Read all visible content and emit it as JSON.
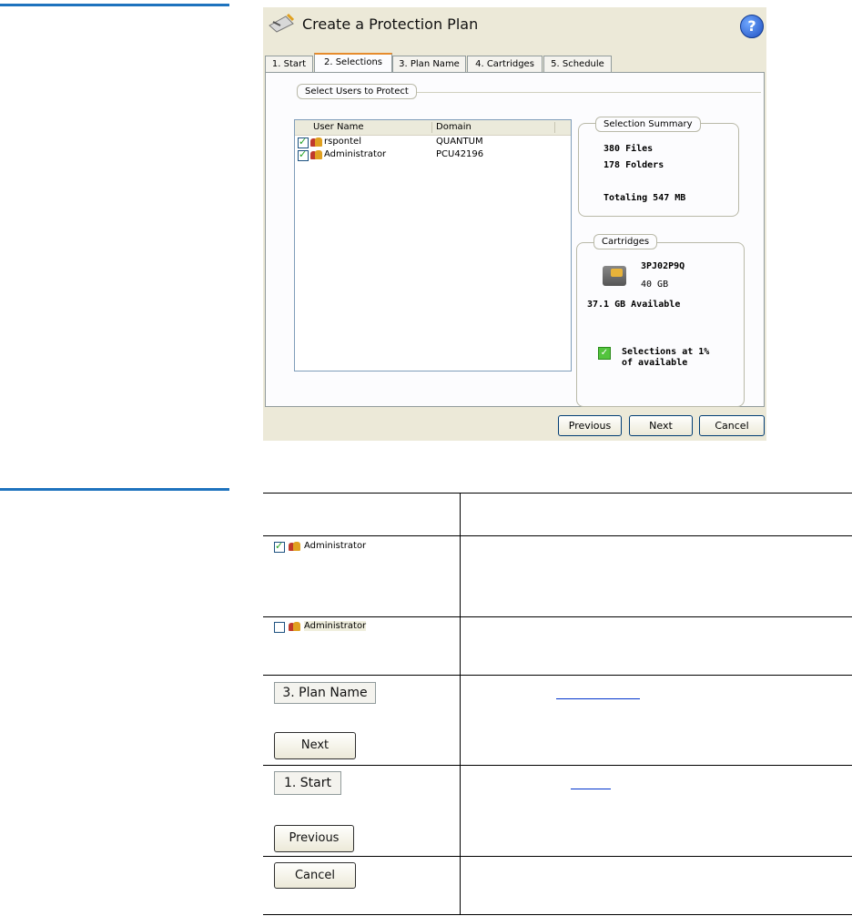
{
  "window": {
    "title": "Create a Protection Plan",
    "help_label": "?"
  },
  "tabs": [
    {
      "label": "1. Start"
    },
    {
      "label": "2. Selections"
    },
    {
      "label": "3. Plan Name"
    },
    {
      "label": "4. Cartridges"
    },
    {
      "label": "5. Schedule"
    }
  ],
  "users_group": {
    "legend": "Select Users to Protect",
    "columns": [
      "User Name",
      "Domain"
    ],
    "rows": [
      {
        "user": "rspontel",
        "domain": "QUANTUM",
        "checked": true
      },
      {
        "user": "Administrator",
        "domain": "PCU42196",
        "checked": true
      }
    ]
  },
  "summary": {
    "legend": "Selection Summary",
    "files": "380 Files",
    "folders": "178 Folders",
    "total": "Totaling 547 MB"
  },
  "cartridges": {
    "legend": "Cartridges",
    "id": "3PJ02P9Q",
    "size": "40 GB",
    "available": "37.1 GB Available",
    "status_line1": "Selections at 1%",
    "status_line2": "of available"
  },
  "buttons": {
    "previous": "Previous",
    "next": "Next",
    "cancel": "Cancel"
  },
  "reference_table": {
    "checked_item": "Administrator",
    "unchecked_item": "Administrator",
    "plan_name_tab": "3. Plan Name",
    "next": "Next",
    "start_tab": "1. Start",
    "previous": "Previous",
    "cancel": "Cancel"
  }
}
